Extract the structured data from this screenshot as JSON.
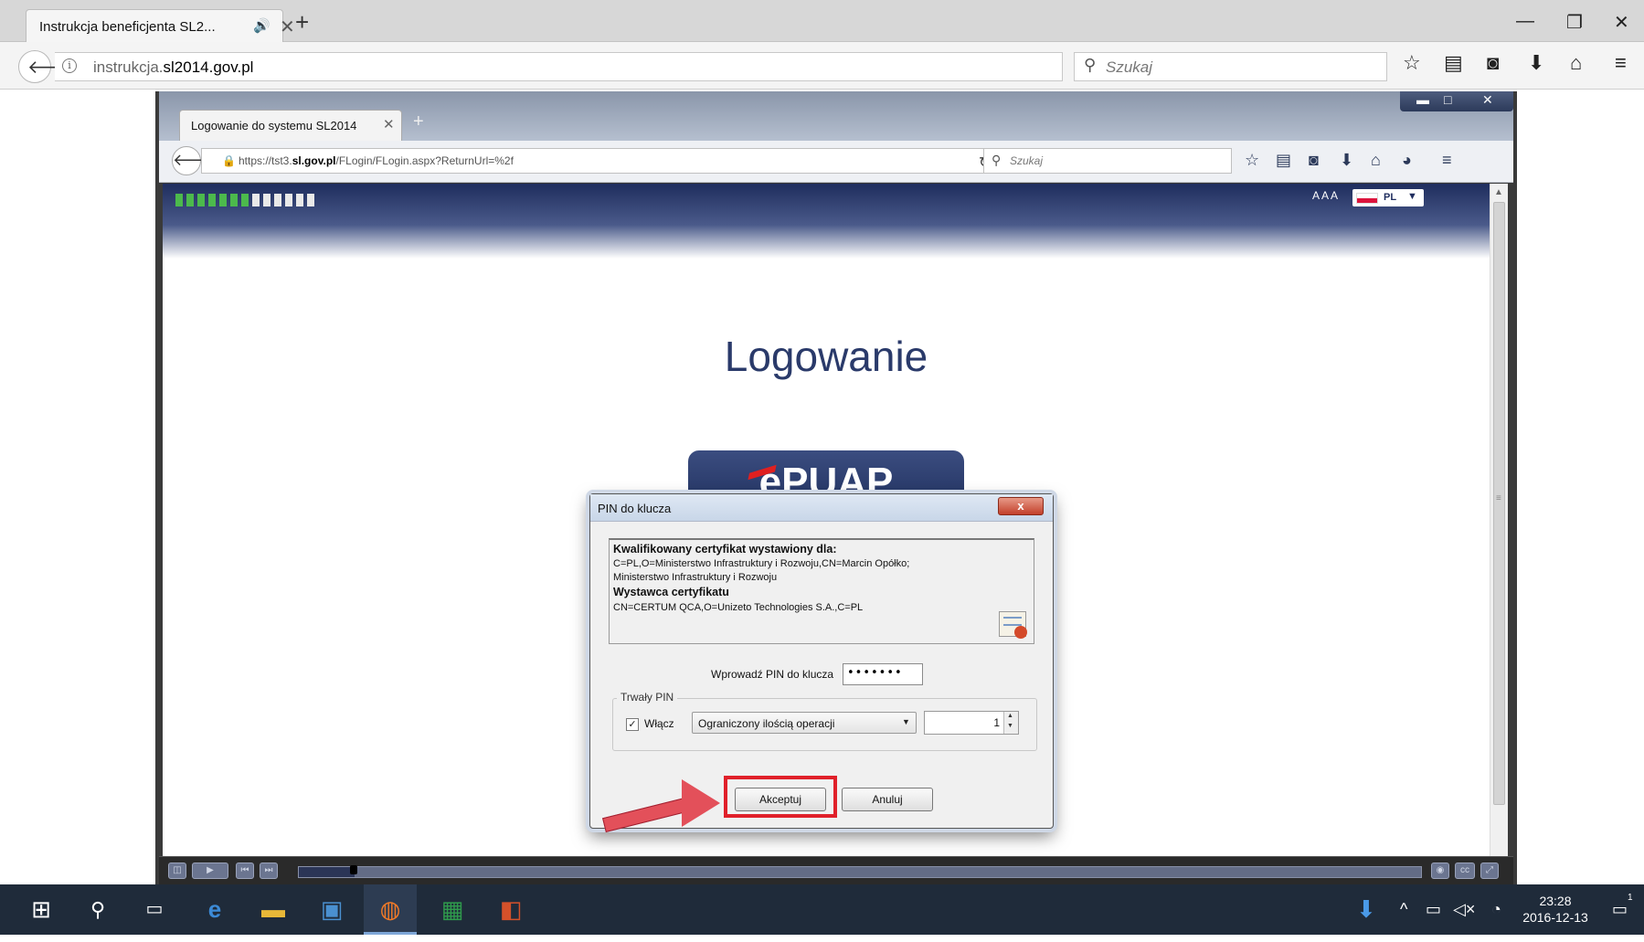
{
  "outer_browser": {
    "tab_title": "Instrukcja beneficjenta SL2...",
    "tab_audio_icon": "speaker-icon",
    "url_prefix": "instrukcja.",
    "url_domain": "sl2014.gov.pl",
    "search_placeholder": "Szukaj",
    "window_controls": [
      "minimize",
      "restore",
      "close"
    ]
  },
  "inner_browser": {
    "tab_title": "Logowanie do systemu SL2014",
    "url_prefix": "https://tst3.",
    "url_domain": "sl.gov.pl",
    "url_path": "/FLogin/FLogin.aspx?ReturnUrl=%2f",
    "search_placeholder": "Szukaj"
  },
  "page": {
    "font_size_control": "A A A",
    "language": "PL",
    "title": "Logowanie",
    "epuap_label": "ePUAP"
  },
  "dialog": {
    "title": "PIN do klucza",
    "close_label": "x",
    "cert_heading": "Kwalifikowany certyfikat wystawiony dla:",
    "cert_subject_1": "C=PL,O=Ministerstwo Infrastruktury i Rozwoju,CN=Marcin Opółko;",
    "cert_subject_2": "Ministerstwo Infrastruktury i Rozwoju",
    "issuer_heading": "Wystawca certyfikatu",
    "issuer_value": "CN=CERTUM QCA,O=Unizeto Technologies S.A.,C=PL",
    "pin_label": "Wprowadź PIN do klucza",
    "pin_value": "•••••••",
    "permanent_pin_legend": "Trwały PIN",
    "enable_label": "Włącz",
    "enable_checked": true,
    "mode_select_value": "Ograniczony ilością operacji",
    "count_value": "1",
    "accept_label": "Akceptuj",
    "cancel_label": "Anuluj"
  },
  "video_controls": {
    "progress": 0.05
  },
  "taskbar": {
    "time": "23:28",
    "date": "2016-12-13",
    "notification_count": "1"
  },
  "colors": {
    "header_navy": "#1f2d5e",
    "highlight_red": "#e0202a",
    "epuap_navy": "#1d2d5a",
    "taskbar_bg": "#1f2b3a"
  }
}
